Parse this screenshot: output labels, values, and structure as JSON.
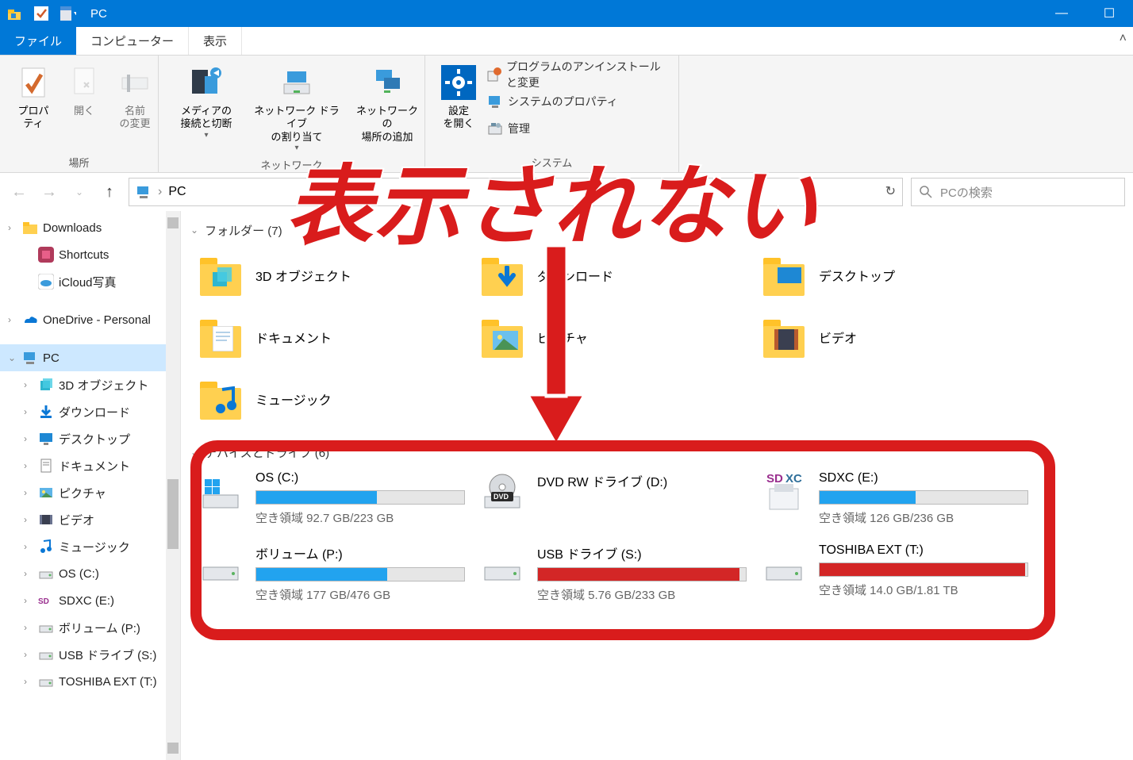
{
  "title_bar": {
    "app_title": "PC"
  },
  "window_controls": {
    "minimize": "—",
    "maximize": "☐"
  },
  "tabs": {
    "file": "ファイル",
    "computer": "コンピューター",
    "view": "表示"
  },
  "ribbon": {
    "groups": {
      "location": {
        "label": "場所",
        "properties": "プロパティ",
        "open": "開く",
        "rename": "名前\nの変更"
      },
      "network": {
        "label": "ネットワーク",
        "media": "メディアの\n接続と切断",
        "map_drive": "ネットワーク ドライブ\nの割り当て",
        "add_location": "ネットワークの\n場所の追加"
      },
      "system": {
        "label": "システム",
        "open_settings": "設定\nを開く",
        "uninstall": "プログラムのアンインストールと変更",
        "sys_props": "システムのプロパティ",
        "manage": "管理"
      }
    }
  },
  "nav": {
    "breadcrumb": "PC",
    "search_placeholder": "PCの検索"
  },
  "tree": {
    "items": [
      {
        "label": "Downloads",
        "icon": "folder",
        "twisty": "›",
        "indent": 0
      },
      {
        "label": "Shortcuts",
        "icon": "shortcut",
        "twisty": "",
        "indent": 1
      },
      {
        "label": "iCloud写真",
        "icon": "icloud",
        "twisty": "",
        "indent": 1
      },
      {
        "label": "OneDrive - Personal",
        "icon": "onedrive",
        "twisty": "›",
        "indent": 0
      },
      {
        "label": "PC",
        "icon": "pc",
        "twisty": "⌄",
        "indent": 0,
        "selected": true
      },
      {
        "label": "3D オブジェクト",
        "icon": "3d",
        "twisty": "›",
        "indent": 1
      },
      {
        "label": "ダウンロード",
        "icon": "download",
        "twisty": "›",
        "indent": 1
      },
      {
        "label": "デスクトップ",
        "icon": "desktop",
        "twisty": "›",
        "indent": 1
      },
      {
        "label": "ドキュメント",
        "icon": "doc",
        "twisty": "›",
        "indent": 1
      },
      {
        "label": "ピクチャ",
        "icon": "pic",
        "twisty": "›",
        "indent": 1
      },
      {
        "label": "ビデオ",
        "icon": "video",
        "twisty": "›",
        "indent": 1
      },
      {
        "label": "ミュージック",
        "icon": "music",
        "twisty": "›",
        "indent": 1
      },
      {
        "label": "OS (C:)",
        "icon": "drive",
        "twisty": "›",
        "indent": 1
      },
      {
        "label": "SDXC (E:)",
        "icon": "sd",
        "twisty": "›",
        "indent": 1
      },
      {
        "label": "ボリューム (P:)",
        "icon": "drive",
        "twisty": "›",
        "indent": 1
      },
      {
        "label": "USB ドライブ (S:)",
        "icon": "drive",
        "twisty": "›",
        "indent": 1
      },
      {
        "label": "TOSHIBA EXT (T:)",
        "icon": "drive",
        "twisty": "›",
        "indent": 1
      }
    ]
  },
  "content": {
    "section_folders": {
      "label": "フォルダー (7)",
      "count": 7
    },
    "folders": [
      {
        "label": "3D オブジェクト"
      },
      {
        "label": "ダウンロード"
      },
      {
        "label": "デスクトップ"
      },
      {
        "label": "ドキュメント"
      },
      {
        "label": "ピクチャ"
      },
      {
        "label": "ビデオ"
      },
      {
        "label": "ミュージック"
      }
    ],
    "section_drives": {
      "label": "デバイスとドライブ (6)",
      "count": 6
    },
    "drives": [
      {
        "label": "OS (C:)",
        "free": "空き領域 92.7 GB/223 GB",
        "fill": 58,
        "color": "#22a3ef",
        "icon": "os"
      },
      {
        "label": "DVD RW ドライブ (D:)",
        "free": "",
        "fill": null,
        "icon": "dvd"
      },
      {
        "label": "SDXC (E:)",
        "free": "空き領域 126 GB/236 GB",
        "fill": 46,
        "color": "#22a3ef",
        "icon": "sdxc"
      },
      {
        "label": "ボリューム (P:)",
        "free": "空き領域 177 GB/476 GB",
        "fill": 63,
        "color": "#22a3ef",
        "icon": "hdd"
      },
      {
        "label": "USB ドライブ (S:)",
        "free": "空き領域 5.76 GB/233 GB",
        "fill": 97,
        "color": "#d32626",
        "icon": "hdd"
      },
      {
        "label": "TOSHIBA EXT (T:)",
        "free": "空き領域 14.0 GB/1.81 TB",
        "fill": 99,
        "color": "#d32626",
        "icon": "hdd"
      }
    ]
  },
  "overlay": {
    "text": "表示されない"
  }
}
